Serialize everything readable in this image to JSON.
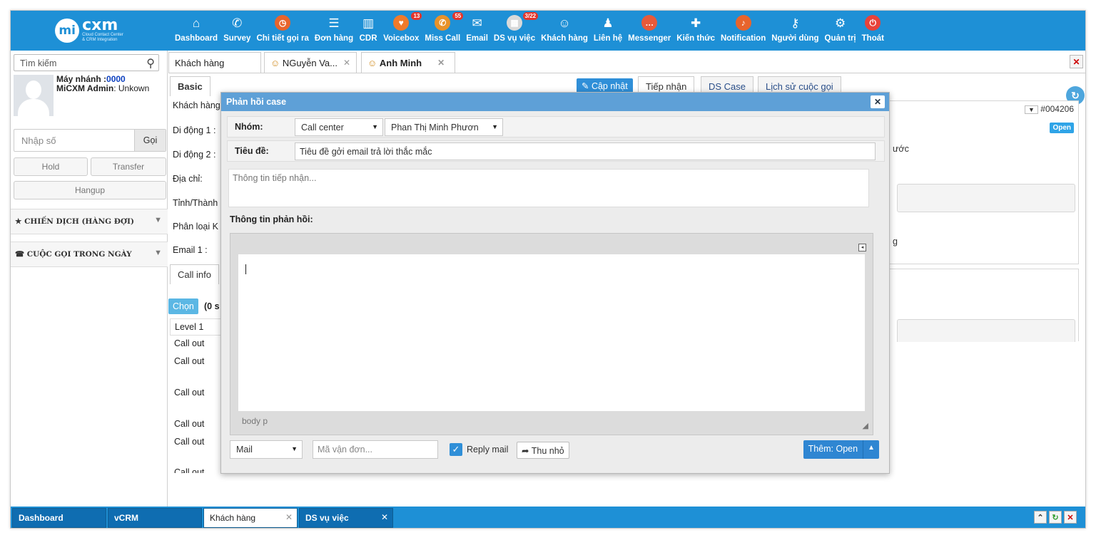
{
  "app": {
    "logo_text": "cxm",
    "logo_prefix": "mi",
    "logo_sub1": "Cloud Contact Center",
    "logo_sub2": "& CRM Integration"
  },
  "nav": [
    {
      "label": "Dashboard",
      "icon": "home-icon",
      "glyph": "⌂"
    },
    {
      "label": "Survey",
      "icon": "phone-icon",
      "glyph": "✆"
    },
    {
      "label": "Chi tiết gọi ra",
      "icon": "clock-icon",
      "glyph": "◷"
    },
    {
      "label": "Đơn hàng",
      "icon": "list-icon",
      "glyph": "☰"
    },
    {
      "label": "CDR",
      "icon": "chart-icon",
      "glyph": "▥"
    },
    {
      "label": "Voicebox",
      "icon": "voicebox-icon",
      "glyph": "♥",
      "badge": "13"
    },
    {
      "label": "Miss Call",
      "icon": "miss-call-icon",
      "glyph": "✆",
      "badge": "55"
    },
    {
      "label": "Email",
      "icon": "envelope-icon",
      "glyph": "✉"
    },
    {
      "label": "DS vụ việc",
      "icon": "calendar-icon",
      "glyph": "▦",
      "badge": "3/22"
    },
    {
      "label": "Khách hàng",
      "icon": "customers-icon",
      "glyph": "☺"
    },
    {
      "label": "Liên hệ",
      "icon": "contact-icon",
      "glyph": "♟"
    },
    {
      "label": "Messenger",
      "icon": "messenger-icon",
      "glyph": "…"
    },
    {
      "label": "Kiến thức",
      "icon": "lifebuoy-icon",
      "glyph": "✚"
    },
    {
      "label": "Notification",
      "icon": "bell-icon",
      "glyph": "♪"
    },
    {
      "label": "Người dùng",
      "icon": "key-icon",
      "glyph": "⚷"
    },
    {
      "label": "Quản trị",
      "icon": "gear-icon",
      "glyph": "⚙"
    },
    {
      "label": "Thoát",
      "icon": "power-icon",
      "glyph": "⏻"
    }
  ],
  "left": {
    "search_text": "Tìm kiếm",
    "ext_label": "Máy nhánh :",
    "ext_value": "0000",
    "user_name": "MiCXM Admin",
    "user_status": ": Unkown",
    "dial_placeholder": "Nhập số",
    "call_label": "Gọi",
    "hold_label": "Hold",
    "transfer_label": "Transfer",
    "hangup_label": "Hangup",
    "campaign_label": "★ CHIẾN DỊCH (HÀNG ĐỢI)",
    "daily_calls_label": "☎ CUỘC GỌI TRONG NGÀY"
  },
  "tabs": {
    "t1": "Khách hàng",
    "t2": "NGuyễn Va...",
    "t3": "Anh Minh"
  },
  "form": {
    "basic_tab": "Basic",
    "customer": "Khách hàng",
    "mobile1": "Di động 1 :",
    "mobile2": "Di động 2 :",
    "address": "Địa chỉ:",
    "province": "Tỉnh/Thành",
    "category": "Phân loại K",
    "email1": "Email 1 :",
    "call_info": "Call info",
    "choose": "Chọn",
    "selected_count": "(0 s",
    "level": "Level 1",
    "call_rows": [
      "Call out",
      "Call out",
      "Call out",
      "Call out",
      "Call out",
      "Call out"
    ]
  },
  "subtabs": {
    "update": "Cập nhật",
    "receive": "Tiếp nhận",
    "case_list": "DS Case",
    "call_history": "Lịch sử cuộc gọi"
  },
  "right_panel": {
    "case_id": "#004206",
    "status": "Open",
    "fragment1": "ước",
    "fragment2": "g"
  },
  "modal": {
    "title": "Phản hồi case",
    "group_label": "Nhóm:",
    "group_value": "Call center",
    "assignee_value": "Phan Thị Minh Phươn",
    "subject_label": "Tiêu đề:",
    "subject_value": "Tiêu đề gởi email trả lời thắc mắc",
    "receive_placeholder": "Thông tin tiếp nhận...",
    "feedback_label": "Thông tin phản hồi:",
    "editor_path": "body  p",
    "channel_value": "Mail",
    "tracking_placeholder": "Mã vận đơn...",
    "reply_mail_label": "Reply mail",
    "minimize_label": "Thu nhỏ",
    "add_button_label": "Thêm: Open"
  },
  "bottom": {
    "tabs": [
      "Dashboard",
      "vCRM",
      "Khách hàng",
      "DS vụ việc"
    ]
  },
  "colors": {
    "primary": "#1e90d6",
    "modal_header": "#5ea0d7",
    "button_blue": "#2f86d2",
    "badge_red": "#e4342a",
    "status_open": "#2fa4e7"
  }
}
